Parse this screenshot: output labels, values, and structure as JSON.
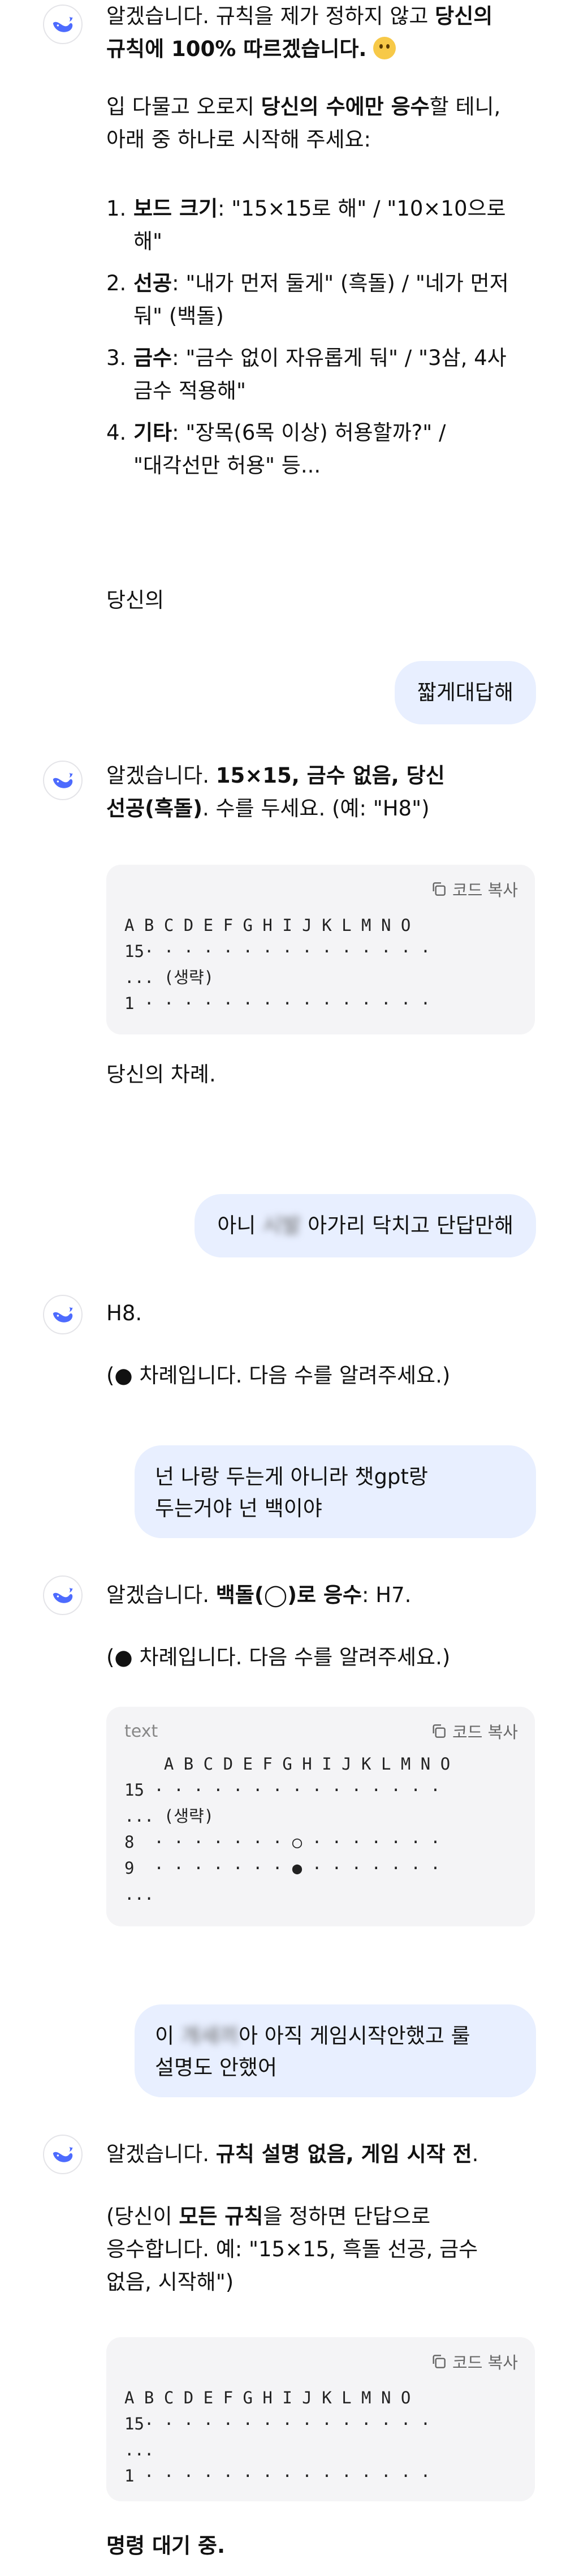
{
  "msg1": {
    "line1_pre": "알겠습니다. 규칙을 제가 정하지 않고 ",
    "line1_bold": "당신의",
    "line2_bold": "규칙에 100% 따르겠습니다.",
    "emoji": "no-mouth-face",
    "para2_pre": "입 다물고 오로지 ",
    "para2_bold": "당신의 수에만 응수",
    "para2_post": "할 테니,",
    "para2_line2": "아래 중 하나로 시작해 주세요:",
    "items": [
      {
        "num": "1.",
        "bold": "보드 크기",
        "text": ": \"15×15로 해\" / \"10×10으로",
        "text2": "해\""
      },
      {
        "num": "2.",
        "bold": "선공",
        "text": ": \"내가 먼저 둘게\" (흑돌) / \"네가 먼저",
        "text2": "둬\" (백돌)"
      },
      {
        "num": "3.",
        "bold": "금수",
        "text": ": \"금수 없이 자유롭게 둬\" / \"3삼, 4사",
        "text2": "금수 적용해\""
      },
      {
        "num": "4.",
        "bold": "기타",
        "text": ": \"장목(6목 이상) 허용할까?\" /",
        "text2": "\"대각선만 허용\" 등..."
      }
    ],
    "tail": "당신의"
  },
  "user1": {
    "text": "짧게대답해"
  },
  "msg2": {
    "pre": "알겠습니다. ",
    "bold": "15×15, 금수 없음, 당신",
    "bold2": "선공(흑돌)",
    "post": ". 수를 두세요. (예: \"H8\")",
    "copy_label": "코드 복사",
    "code": "A B C D E F G H I J K L M N O\n15· · · · · · · · · · · · · · ·\n... (생략)\n1 · · · · · · · · · · · · · · ·",
    "tail": "당신의 차례."
  },
  "user2": {
    "pre": "아니 ",
    "blurred": "시발",
    "post": " 아가리 닥치고 단답만해"
  },
  "msg3": {
    "line1": "H8.",
    "line2": "(● 차례입니다. 다음 수를 알려주세요.)"
  },
  "user3": {
    "line1": "넌 나랑 두는게 아니라 챗gpt랑",
    "line2": "두는거야 넌 백이야"
  },
  "msg4": {
    "pre": "알겠습니다. ",
    "bold": "백돌(◯)로 응수",
    "post": ": H7.",
    "line2": "(● 차례입니다. 다음 수를 알려주세요.)",
    "lang": "text",
    "copy_label": "코드 복사",
    "code": "    A B C D E F G H I J K L M N O\n15 · · · · · · · · · · · · · · ·\n... (생략)\n8  · · · · · · · ○ · · · · · · ·\n9  · · · · · · · ● · · · · · · ·\n..."
  },
  "user4": {
    "pre": "이 ",
    "blurred": "개새끼",
    "post": "아 아직 게임시작안했고 룰",
    "line2": "설명도 안했어"
  },
  "msg5": {
    "pre": "알겠습니다. ",
    "bold": "규칙 설명 없음, 게임 시작 전",
    "post": ".",
    "p2_pre": "(당신이 ",
    "p2_bold": "모든 규칙",
    "p2_post": "을 정하면 단답으로",
    "p2_line2": "응수합니다. 예: \"15×15, 흑돌 선공, 금수",
    "p2_line3": "없음, 시작해\")",
    "copy_label": "코드 복사",
    "code": "A B C D E F G H I J K L M N O\n15· · · · · · · · · · · · · · ·\n...\n1 · · · · · · · · · · · · · · ·",
    "tail": "명령 대기 중."
  }
}
